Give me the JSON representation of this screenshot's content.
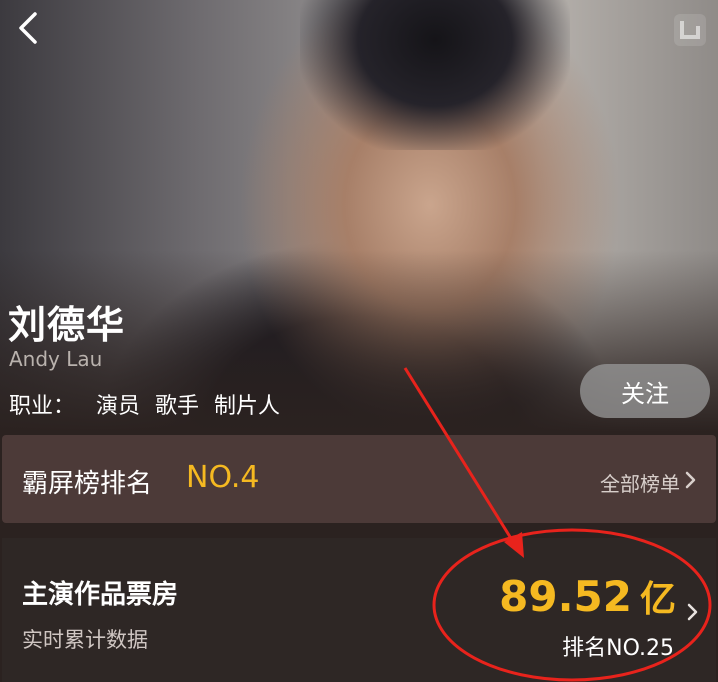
{
  "profile": {
    "name": "刘德华",
    "english_name": "Andy Lau",
    "occupation_label": "职业：",
    "occupations": [
      "演员",
      "歌手",
      "制片人"
    ],
    "follow_label": "关注"
  },
  "ranking": {
    "title": "霸屏榜排名",
    "value": "NO.4",
    "all_link": "全部榜单"
  },
  "box_office": {
    "title": "主演作品票房",
    "subtitle": "实时累计数据",
    "amount": "89.52",
    "unit": "亿",
    "rank": "排名NO.25"
  },
  "colors": {
    "accent": "#f5b921",
    "annotation": "#e8231c",
    "ranking_card_bg": "#4c3a38",
    "page_bg": "#2b2220"
  },
  "icons": {
    "back": "chevron-left-icon",
    "corner": "app-logo-icon",
    "chevron": "chevron-right-icon"
  }
}
